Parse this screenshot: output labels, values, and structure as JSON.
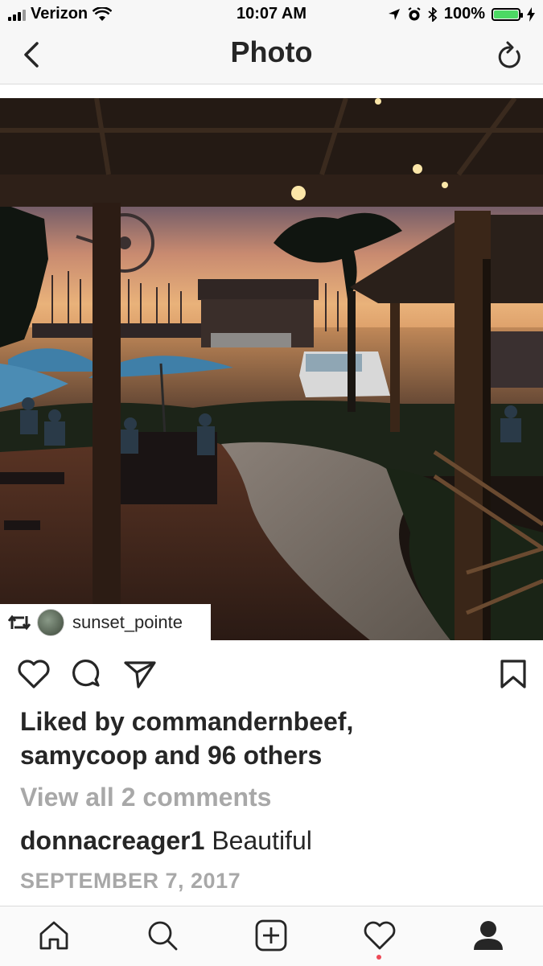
{
  "status_bar": {
    "carrier": "Verizon",
    "time": "10:07 AM",
    "battery_percent": "100%",
    "battery_level": 1.0,
    "battery_color": "#4cd964"
  },
  "nav": {
    "title": "Photo",
    "back_icon": "chevron-left-icon",
    "refresh_icon": "refresh-icon"
  },
  "post": {
    "repost_icon": "repost-icon",
    "repost_username": "sunset_pointe",
    "liked_by_prefix": "Liked by ",
    "liked_by_user1": "commandernbeef,",
    "liked_by_user2": "samycoop",
    "liked_by_conjunction": " and ",
    "liked_by_others": "96 others",
    "view_comments": "View all 2 comments",
    "comment_user": "donnacreager1",
    "comment_text": "Beautiful",
    "date": "SEPTEMBER 7, 2017"
  },
  "tabs": [
    {
      "icon": "home-icon"
    },
    {
      "icon": "search-icon"
    },
    {
      "icon": "add-post-icon"
    },
    {
      "icon": "heart-icon"
    },
    {
      "icon": "profile-icon"
    }
  ],
  "colors": {
    "notification_dot": "#ed4956",
    "secondary_text": "#a8a8a8"
  }
}
